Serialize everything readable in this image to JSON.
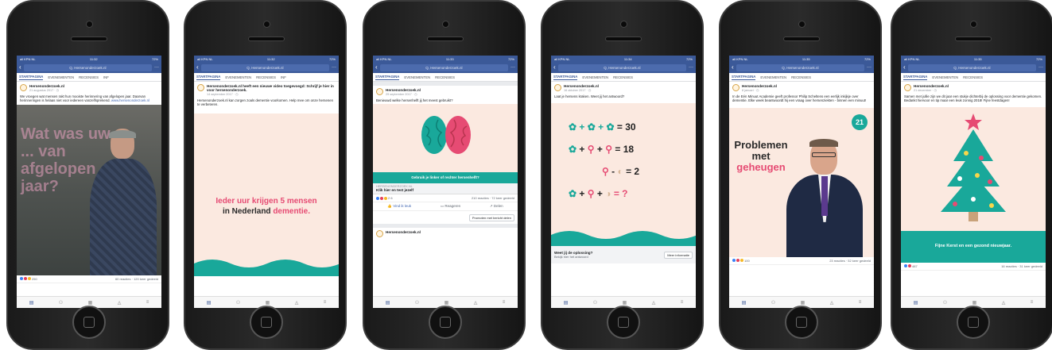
{
  "common": {
    "search_text": "Q, Hersenonderzoek.nl",
    "tab_home": "STARTPAGINA",
    "tab_events": "EVENEMENTEN",
    "tab_reviews": "RECENSIES",
    "tab_extra": "INF",
    "page_name": "Hersenonderzoek.nl"
  },
  "p1": {
    "status_left": "all KPN NL",
    "status_time": "11:32",
    "status_right": "72%",
    "date": "21 augustus 2017 · ◷",
    "text": "We vroegen wat mensen rakt hun mooiste herinnering van afgelopen jaar. Daarvan herinneringen is helaas niet voor iedereen vanzelfsprekend.",
    "link": "www.hersenonderzoek.nl",
    "overlay": "Wat was uw ... van afgelopen jaar?",
    "reactions_count": "250",
    "reactions_stats": "60 reacties · 120 keer gedeeld"
  },
  "p2": {
    "status_left": "all KPN NL",
    "status_time": "11:32",
    "status_right": "72%",
    "head": "Hersenonderzoek.nl heeft een nieuwe video toegevoegd: Schrijf je hier in voor hersenonderzoek.",
    "date": "14 september 2017 · ◷",
    "text": "Hersenonderzoek.nl kan zorgen zoals dementie voorkomen. Help mee om onze hersenen te verbeteren.",
    "headline_a": "Ieder uur krijgen ",
    "headline_b": "5 mensen",
    "headline_c": "in Nederland ",
    "headline_d": "dementie."
  },
  "p3": {
    "status_left": "all KPN NL",
    "status_time": "11:33",
    "status_right": "72%",
    "date": "29 september 2017 · ◷",
    "text": "Benieuwd welke hersenhelft jij het meest gebruikt?",
    "banner": "Gebruik je linker of rechter hersenhelft?",
    "link_domain": "HERSENONDERZOEK.NL",
    "link_title": "Klik hier en test jezelf",
    "reactions_count": "2 6",
    "reactions_stats": "210 reacties · 72 keer gedeeld",
    "like": "Vind ik leuk",
    "comment": "Reageren",
    "share": "Delen",
    "promote": "Promoten met bericht delen",
    "next_post": "Hersenonderzoek.nl"
  },
  "p4": {
    "status_left": "all KPN NL",
    "status_time": "11:34",
    "status_right": "72%",
    "date": "16 oktober 2017 · ◷",
    "text": "Laat je hersens kraken. Weet jij het antwoord?",
    "eq1": "= 30",
    "eq2": "= 18",
    "eq3": "= 2",
    "eq4": "= ?",
    "cta_title": "Weet jij de oplossing?",
    "cta_sub": "Bekijk hier het antwoord",
    "cta_button": "Meer informatie"
  },
  "p5": {
    "status_left": "all KPN NL",
    "status_time": "11:35",
    "status_right": "72%",
    "date": "8 januari · ◷",
    "text": "In de Eén Minuut Academie geeft professor Philip Scheltens een eerlijk inkijkje over dementie. Elke week beantwoordt hij een vraag over hersenziekten - binnen een minuut!",
    "badge": "21",
    "title1": "Problemen",
    "title2": "met",
    "title3": "geheugen",
    "reactions_count": "100",
    "reactions_stats": "23 reacties · 52 keer gedeeld"
  },
  "p6": {
    "status_left": "all KPN NL",
    "status_time": "11:35",
    "status_right": "72%",
    "date": "21 december · ◷",
    "text": "Samen met jullie zijn we dit jaar een stukje dichterbij de oplossing voor dementie gekomen. Bedankt hiervoor en tip maar een leuk zonnig 2018! Fijne feestdagen!",
    "footer": "Fijne Kerst en een gezond nieuwjaar.",
    "reactions_count": "487",
    "reactions_stats": "16 reacties · 31 keer gedeeld"
  },
  "colors": {
    "fb_blue": "#3b5998",
    "teal": "#19a89a",
    "pink": "#e64b73",
    "peach": "#fbe9e0"
  }
}
